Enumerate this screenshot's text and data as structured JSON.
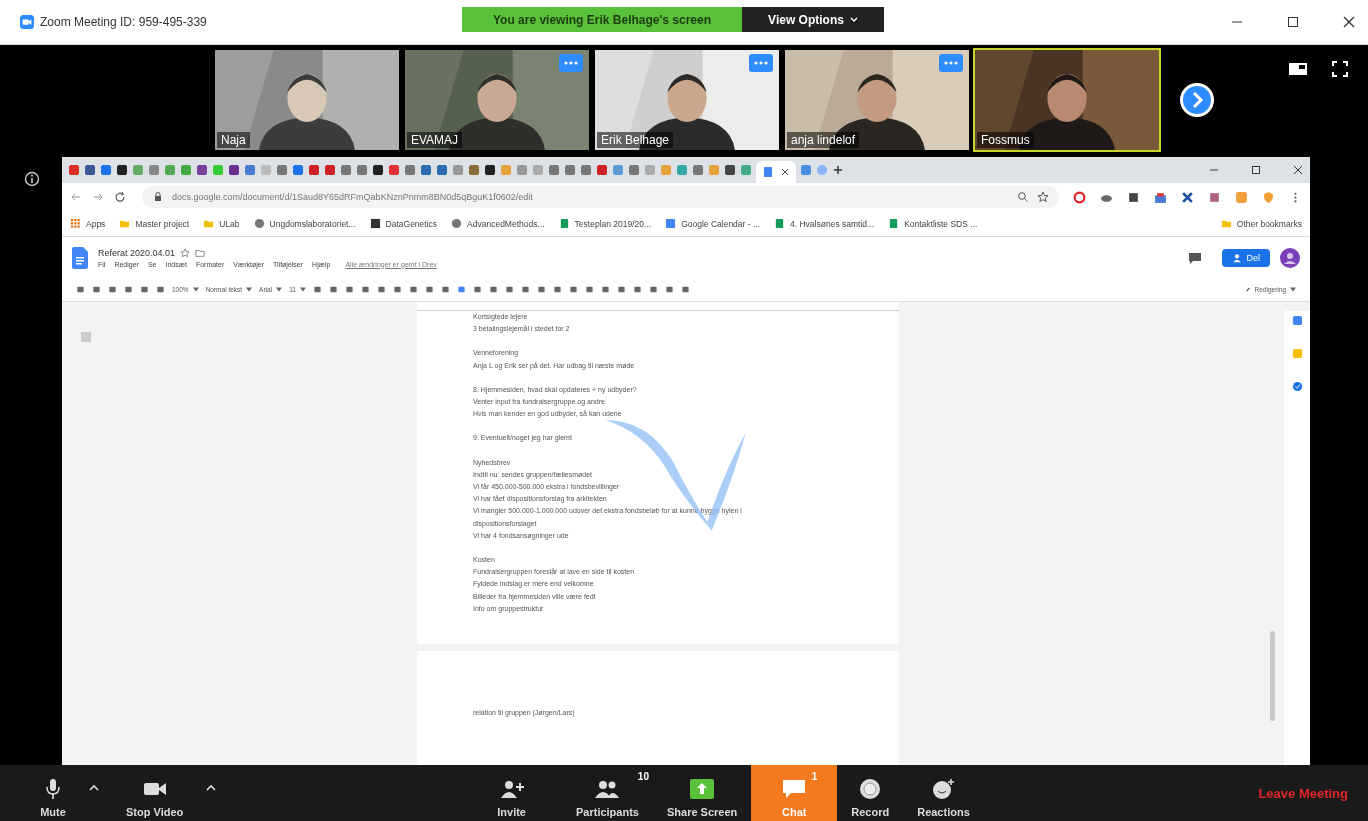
{
  "window": {
    "title": "Zoom Meeting ID: 959-495-339"
  },
  "banner": {
    "text": "You are viewing Erik Belhage's screen",
    "options": "View Options"
  },
  "videos": [
    {
      "name": "Naja",
      "more": false,
      "speaking": false
    },
    {
      "name": "EVAMAJ",
      "more": true,
      "speaking": false
    },
    {
      "name": "Erik Belhage",
      "more": true,
      "speaking": false
    },
    {
      "name": "anja lindelof",
      "more": true,
      "speaking": false
    },
    {
      "name": "Fossmus",
      "more": false,
      "speaking": true
    }
  ],
  "browser": {
    "url": "docs.google.com/document/d/1Saud8Y65dRFmQabKNznPnmm8BN0d5qBguK1f0602/edit",
    "bookmarks": [
      {
        "label": "Apps",
        "kind": "apps"
      },
      {
        "label": "Master project",
        "kind": "folder"
      },
      {
        "label": "ULab",
        "kind": "folder"
      },
      {
        "label": "Ungdomslaboratoriet...",
        "kind": "globe"
      },
      {
        "label": "DataGenetics",
        "kind": "site"
      },
      {
        "label": "AdvancedMethods...",
        "kind": "globe"
      },
      {
        "label": "Testeplan 2019/20...",
        "kind": "sheet"
      },
      {
        "label": "Google Calendar - ...",
        "kind": "calendar"
      },
      {
        "label": "4. Hvalsønes samtid...",
        "kind": "sheet"
      },
      {
        "label": "Kontaktliste SDS ...",
        "kind": "sheet"
      }
    ],
    "other_bookmarks": "Other bookmarks"
  },
  "doc": {
    "title": "Referat 2020.04.01",
    "menus": [
      "Fil",
      "Rediger",
      "Se",
      "Indsæt",
      "Formater",
      "Værktøjer",
      "Tilføjelser",
      "Hjælp"
    ],
    "save_status": "Alle ændringer er gemt i Drev",
    "share": "Del",
    "zoom": "100%",
    "style": "Normal tekst",
    "font": "Arial",
    "size": "11",
    "mode": "Redigering",
    "pages": [
      [
        [
          "Kortsigtede lejere",
          "3 betalingslejemål i stedet for 2"
        ],
        [
          "Venneforening",
          "Anja L og Erik ser på det. Har udbag til næste møde"
        ],
        [
          "8. Hjemmesiden, hvad skal opdateres + ny udbyder?",
          "Venter input fra fundraisergruppe og andre",
          "Hvis man kender en god udbyder, så kan udene"
        ],
        [
          "9. Eventuelt/noget jeg har glemt"
        ],
        [
          "Nyhedsbrev",
          "Indtil nu: sendes gruppen/fællesmødet",
          "Vi får 450.000-500.000 ekstra i fondsbevillinger",
          "Vi har fået dispositionsforslag fra arkitekten",
          "Vi mangler 500.000-1.000.000 udover det ekstra fondsbeløb for at kunne bygge hylen i",
          "dispositionsforslaget",
          "Vi har 4 fondsansøgninger ude"
        ],
        [
          "Kosten",
          "Fundraisergruppen foreslår at lave en side til kosten",
          "Fyldede indslag er mere end velkomne",
          "Billeder fra hjemmesiden ville være fedt",
          "Info om gruppestruktur"
        ]
      ],
      [
        [
          "relation til gruppen (Jørgen/Lars)"
        ]
      ]
    ]
  },
  "toolbar": {
    "items": [
      {
        "kind": "mic",
        "label": "Mute",
        "selected": false
      },
      {
        "kind": "caret",
        "selected": false
      },
      {
        "kind": "video",
        "label": "Stop Video",
        "selected": false
      },
      {
        "kind": "caret",
        "selected": false
      },
      {
        "kind": "invite",
        "label": "Invite",
        "selected": false
      },
      {
        "kind": "participants",
        "label": "Participants",
        "badge": "10",
        "selected": false
      },
      {
        "kind": "share",
        "label": "Share Screen",
        "selected": false
      },
      {
        "kind": "chat",
        "label": "Chat",
        "badge": "1",
        "selected": true
      },
      {
        "kind": "record",
        "label": "Record",
        "selected": false
      },
      {
        "kind": "reactions",
        "label": "Reactions",
        "selected": false
      }
    ],
    "leave": "Leave Meeting"
  }
}
